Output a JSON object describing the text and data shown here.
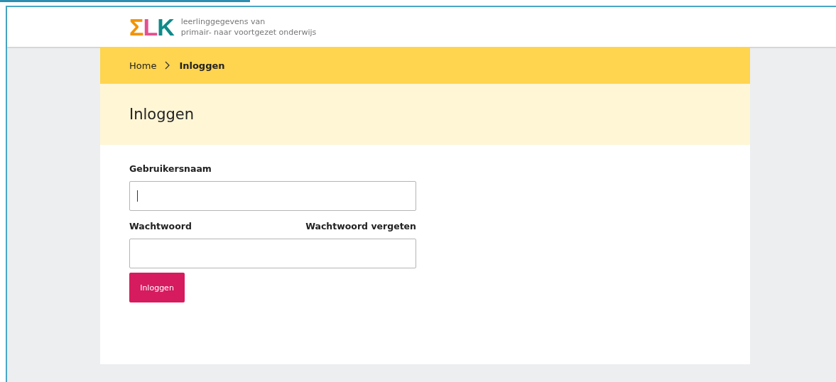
{
  "header": {
    "logo": [
      {
        "text": "Σ",
        "color": "#f29400"
      },
      {
        "text": "L",
        "color": "#e5508f"
      },
      {
        "text": "K",
        "color": "#0e8a8a"
      }
    ],
    "tagline": [
      "leerlinggegevens van",
      "primair- naar voortgezet onderwijs"
    ]
  },
  "breadcrumb": [
    {
      "label": "Home",
      "selected": false
    },
    {
      "label": "Inloggen",
      "selected": true
    }
  ],
  "page_title": "Inloggen",
  "form": {
    "fields": [
      {
        "label": "Gebruikersnaam",
        "focused": true
      },
      {
        "label": "Wachtwoord",
        "link": "Wachtwoord vergeten",
        "focused": false
      }
    ],
    "submit": "Inloggen"
  }
}
